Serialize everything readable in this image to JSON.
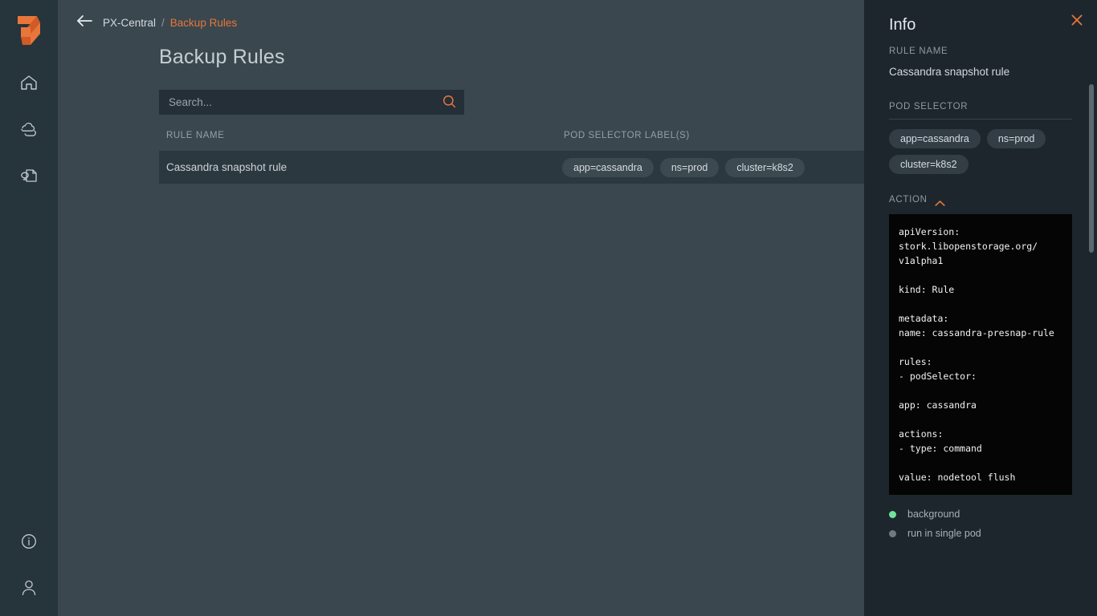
{
  "colors": {
    "accent": "#e8763a",
    "app_bg": "#3a474e",
    "rail_bg": "#26343b",
    "panel_bg": "#1d262d",
    "row_bg": "#2c383f",
    "chip_bg": "#3c4950",
    "code_bg": "#050505",
    "status_on": "#6fe39a",
    "status_off": "#6e7a80"
  },
  "rail": {
    "logo": "portworx-logo",
    "items": [
      {
        "icon": "home-icon",
        "name": "home"
      },
      {
        "icon": "cloud-icon",
        "name": "cloud"
      },
      {
        "icon": "backup-page-icon",
        "name": "backup"
      }
    ],
    "bottom_items": [
      {
        "icon": "info-circle-icon",
        "name": "info"
      },
      {
        "icon": "user-icon",
        "name": "account"
      }
    ]
  },
  "header": {
    "back_icon": "back-arrow-icon",
    "breadcrumb": {
      "root": "PX-Central",
      "separator": "/",
      "current": "Backup Rules"
    },
    "page_title": "Backup Rules"
  },
  "search": {
    "placeholder": "Search...",
    "value": "",
    "icon": "search-icon"
  },
  "table": {
    "columns": [
      "RULE NAME",
      "POD SELECTOR LABEL(S)"
    ],
    "rows": [
      {
        "rule_name": "Cassandra snapshot rule",
        "labels": [
          "app=cassandra",
          "ns=prod",
          "cluster=k8s2"
        ]
      }
    ]
  },
  "panel": {
    "title": "Info",
    "close_icon": "close-icon",
    "rule_name_label": "RULE NAME",
    "rule_name_value": "Cassandra snapshot rule",
    "pod_selector_label": "POD SELECTOR",
    "pod_selector_chips": [
      "app=cassandra",
      "ns=prod",
      "cluster=k8s2"
    ],
    "action_label": "ACTION",
    "action_chevron_icon": "chevron-up-icon",
    "action_yaml": "apiVersion:\nstork.libopenstorage.org/\nv1alpha1\n\nkind: Rule\n\nmetadata:\nname: cassandra-presnap-rule\n\nrules:\n- podSelector:\n\napp: cassandra\n\nactions:\n- type: command\n\nvalue: nodetool flush",
    "options": [
      {
        "label": "background",
        "state": "on"
      },
      {
        "label": "run in single pod",
        "state": "off"
      }
    ]
  }
}
